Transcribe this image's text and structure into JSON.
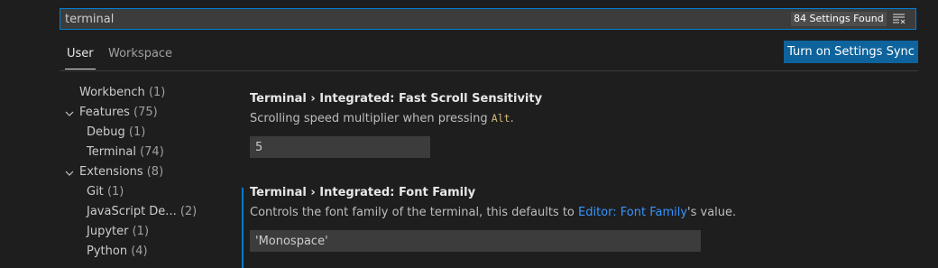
{
  "search": {
    "value": "terminal",
    "results_badge": "84 Settings Found"
  },
  "tabs": [
    {
      "label": "User"
    },
    {
      "label": "Workspace"
    }
  ],
  "sync_button": "Turn on Settings Sync",
  "toc": [
    {
      "label": "Workbench",
      "count": "(1)"
    },
    {
      "label": "Features",
      "count": "(75)"
    },
    {
      "label": "Debug",
      "count": "(1)"
    },
    {
      "label": "Terminal",
      "count": "(74)"
    },
    {
      "label": "Extensions",
      "count": "(8)"
    },
    {
      "label": "Git",
      "count": "(1)"
    },
    {
      "label": "JavaScript De...",
      "count": "(2)"
    },
    {
      "label": "Jupyter",
      "count": "(1)"
    },
    {
      "label": "Python",
      "count": "(4)"
    }
  ],
  "settings": [
    {
      "category": "Terminal › Integrated: ",
      "name": "Fast Scroll Sensitivity",
      "desc_before": "Scrolling speed multiplier when pressing ",
      "desc_code": "Alt",
      "desc_after": ".",
      "value": "5"
    },
    {
      "category": "Terminal › Integrated: ",
      "name": "Font Family",
      "desc_before": "Controls the font family of the terminal, this defaults to ",
      "desc_link": "Editor: Font Family",
      "desc_after": "'s value.",
      "value": "'Monospace'"
    }
  ],
  "colors": {
    "accent": "#007fd4",
    "button": "#0e639c",
    "link": "#3794ff",
    "background": "#1e1e1e"
  }
}
